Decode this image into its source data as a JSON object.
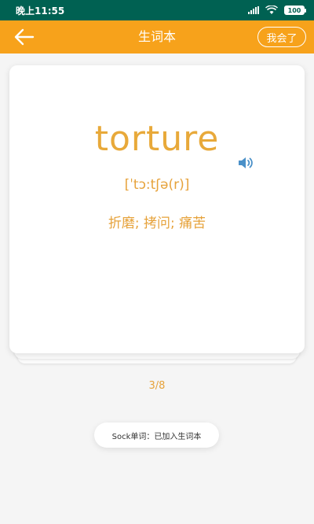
{
  "status_bar": {
    "time": "晚上11:55",
    "battery": "100"
  },
  "header": {
    "title": "生词本",
    "known_button": "我会了"
  },
  "card": {
    "word": "torture",
    "phonetic": "[ˈtɔ:tʃə(r)]",
    "meaning": "折磨; 拷问; 痛苦"
  },
  "pagination": {
    "indicator": "3/8"
  },
  "toast": {
    "message": "Sock单词：已加入生词本"
  },
  "colors": {
    "status_bar": "#006152",
    "app_bar": "#f7a21b",
    "accent_text": "#e6a23a",
    "speaker": "#4a90c8"
  }
}
